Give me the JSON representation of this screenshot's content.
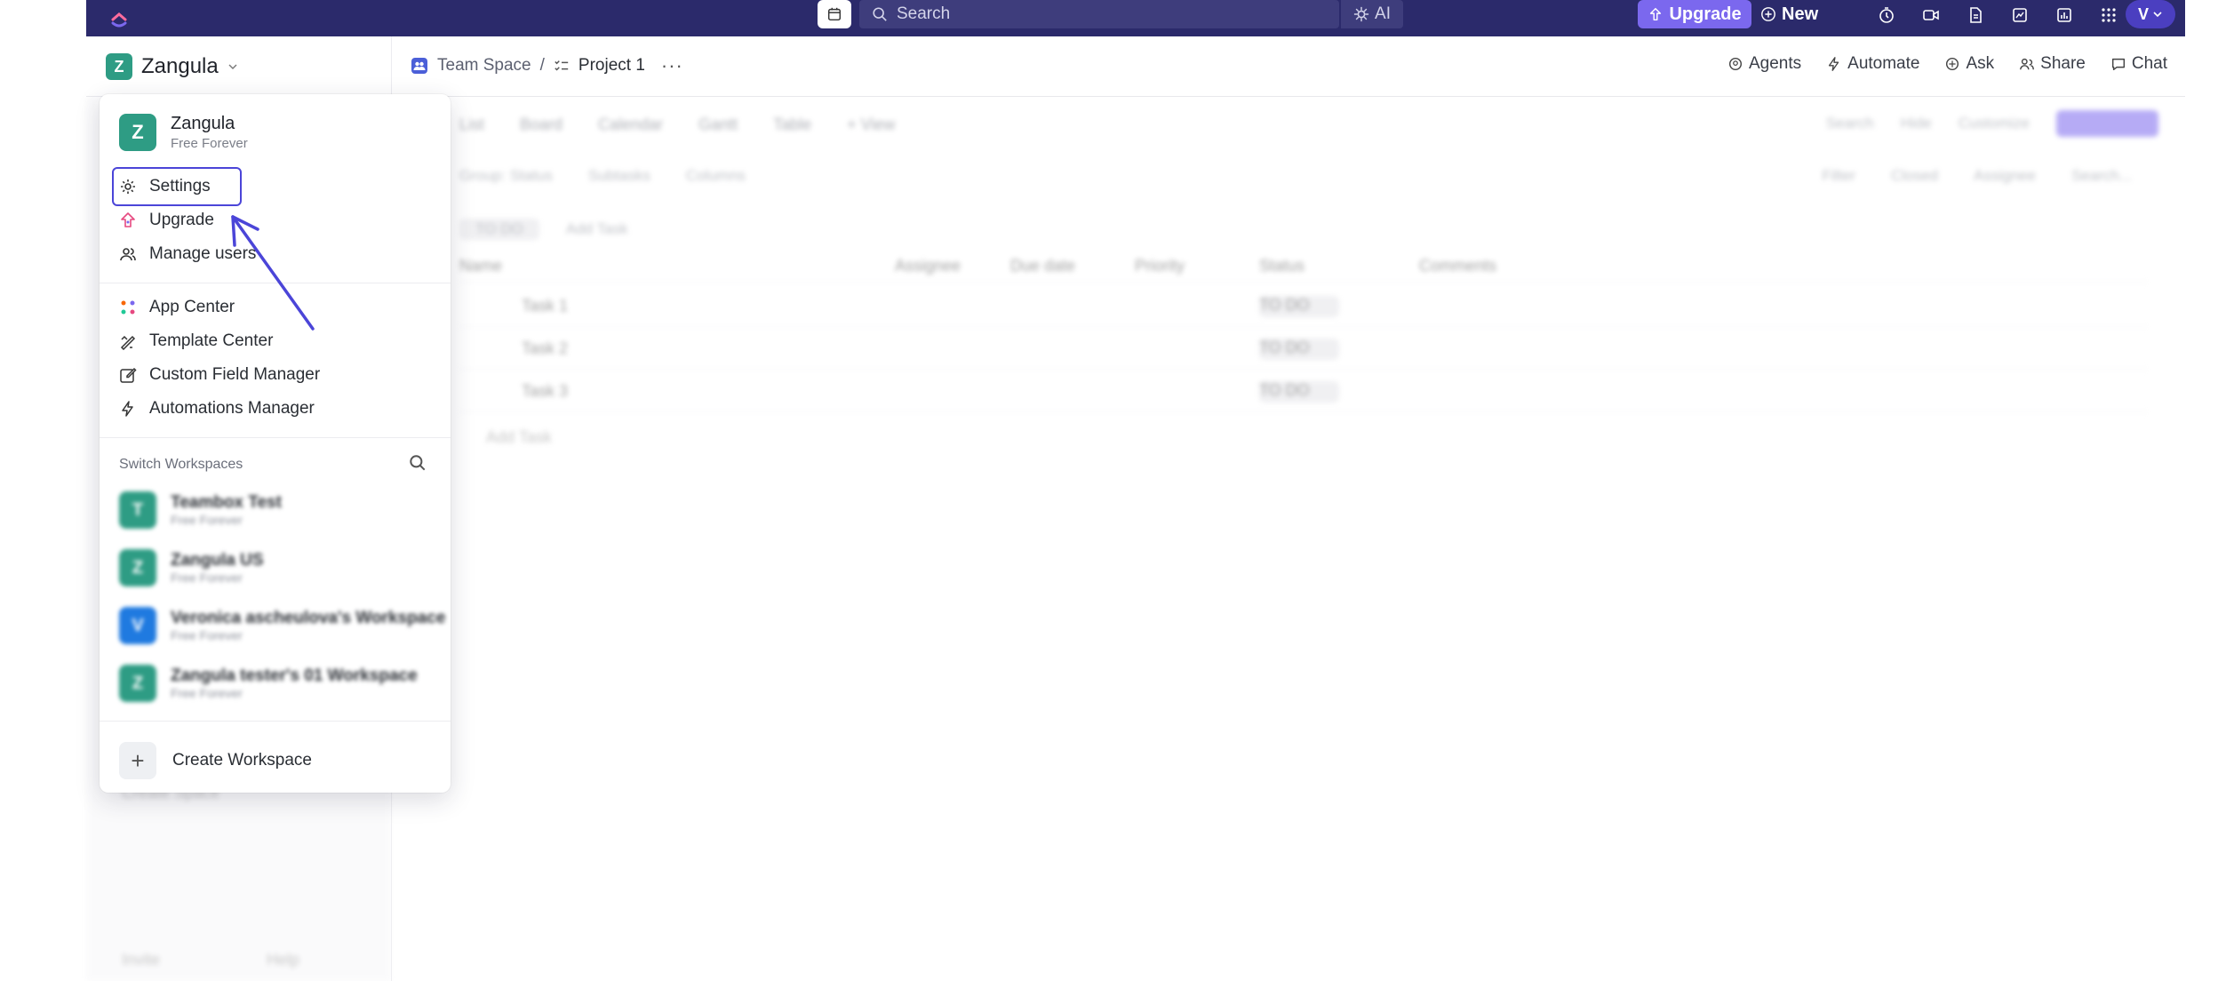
{
  "topbar": {
    "search_placeholder": "Search",
    "ai_label": "AI",
    "upgrade_label": "Upgrade",
    "new_label": "New",
    "avatar_initial": "V",
    "icons": [
      "logo-icon",
      "calendar-icon",
      "search-icon",
      "sparkle-icon",
      "upgrade-icon",
      "plus-circle-icon",
      "timer-icon",
      "video-icon",
      "document-icon",
      "whiteboard-icon",
      "dashboard-icon",
      "apps-grid-icon",
      "chevron-down-icon"
    ],
    "accent_color": "#7b68ee",
    "bar_color": "#2b2a6b"
  },
  "header": {
    "workspace_name": "Zangula",
    "workspace_initial": "Z",
    "breadcrumb": {
      "space": "Team Space",
      "separator": "/",
      "project": "Project 1"
    },
    "actions": {
      "agents": "Agents",
      "automate": "Automate",
      "ask": "Ask",
      "share": "Share",
      "chat": "Chat"
    }
  },
  "background": {
    "toolbar": [
      "List",
      "Board",
      "Calendar",
      "Gantt",
      "Table",
      "+ View"
    ],
    "right_tools": [
      "Search",
      "Hide",
      "Customize"
    ],
    "subtoolbar": [
      "Group: Status",
      "Subtasks",
      "Columns"
    ],
    "subtoolbar_right": [
      "Filter",
      "Closed",
      "Assignee",
      "Search..."
    ],
    "group_label": "TO DO",
    "add_task": "Add Task",
    "columns": [
      "Name",
      "Assignee",
      "Due date",
      "Priority",
      "Status",
      "Comments"
    ],
    "tasks": [
      "Task 1",
      "Task 2",
      "Task 3"
    ],
    "task_status": "TO DO",
    "add_task_row": "Add Task",
    "create_space": "Create Space",
    "footer": [
      "Invite",
      "Help"
    ]
  },
  "dropdown": {
    "workspace": {
      "initial": "Z",
      "name": "Zangula",
      "plan": "Free Forever"
    },
    "menu_primary": [
      {
        "label": "Settings",
        "icon": "gear-icon"
      },
      {
        "label": "Upgrade",
        "icon": "upgrade-icon"
      },
      {
        "label": "Manage users",
        "icon": "users-icon"
      }
    ],
    "menu_secondary": [
      {
        "label": "App Center",
        "icon": "app-center-icon"
      },
      {
        "label": "Template Center",
        "icon": "template-icon"
      },
      {
        "label": "Custom Field Manager",
        "icon": "edit-field-icon"
      },
      {
        "label": "Automations Manager",
        "icon": "lightning-icon"
      }
    ],
    "switch_title": "Switch Workspaces",
    "workspaces": [
      {
        "initial": "T",
        "name": "Teambox Test",
        "plan": "Free Forever",
        "color": "#2e9c84"
      },
      {
        "initial": "Z",
        "name": "Zangula US",
        "plan": "Free Forever",
        "color": "#2e9c84"
      },
      {
        "initial": "V",
        "name": "Veronica ascheulova's Workspace",
        "plan": "Free Forever",
        "color": "#1f7ae0"
      },
      {
        "initial": "Z",
        "name": "Zangula tester's 01 Workspace",
        "plan": "Free Forever",
        "color": "#2e9c84"
      }
    ],
    "create_label": "Create Workspace",
    "create_symbol": "+"
  },
  "annotation": {
    "highlight_color": "#4b45d8"
  }
}
